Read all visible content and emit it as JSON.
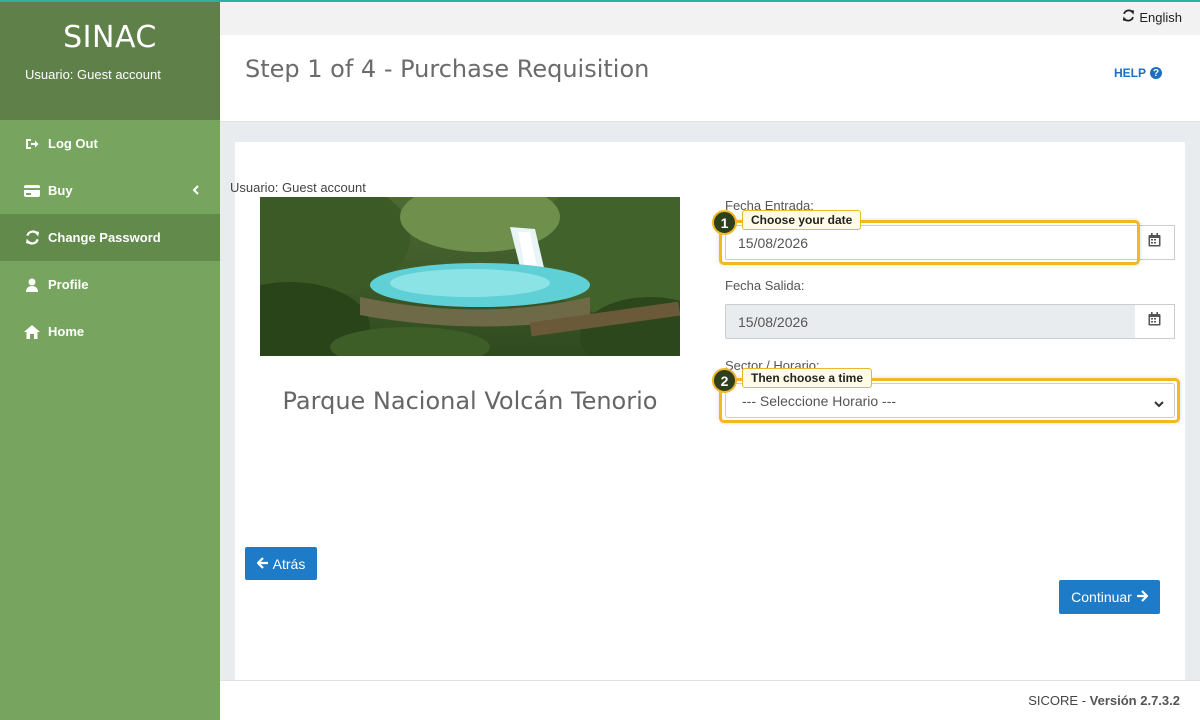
{
  "sidebar": {
    "app_title": "SINAC",
    "user_line": "Usuario: Guest account",
    "items": [
      {
        "label": "Log Out",
        "icon": "sign-out-icon"
      },
      {
        "label": "Buy",
        "icon": "credit-card-icon"
      },
      {
        "label": "Change Password",
        "icon": "refresh-icon"
      },
      {
        "label": "Profile",
        "icon": "user-icon"
      },
      {
        "label": "Home",
        "icon": "home-icon"
      }
    ]
  },
  "topbar": {
    "language": "English"
  },
  "header": {
    "title": "Step 1 of 4 - Purchase Requisition",
    "help": "HELP"
  },
  "main": {
    "usuario": "Usuario: Guest account",
    "park_name": "Parque Nacional Volcán Tenorio",
    "fecha_entrada_label": "Fecha Entrada:",
    "fecha_entrada_value": "15/08/2026",
    "fecha_salida_label": "Fecha Salida:",
    "fecha_salida_value": "15/08/2026",
    "sector_label": "Sector / Horario:",
    "sector_select": "--- Seleccione Horario ---",
    "back_button": "Atrás",
    "continue_button": "Continuar"
  },
  "tips": [
    {
      "number": "1",
      "text": "Choose your date"
    },
    {
      "number": "2",
      "text": "Then choose a time"
    }
  ],
  "footer": {
    "product": "SICORE",
    "separator": " - ",
    "version": "Versión 2.7.3.2"
  },
  "colors": {
    "sidebar": "#77a55f",
    "sidebar_brand": "#5f8049",
    "primary": "#1e7bc7",
    "highlight": "#f1b820"
  }
}
